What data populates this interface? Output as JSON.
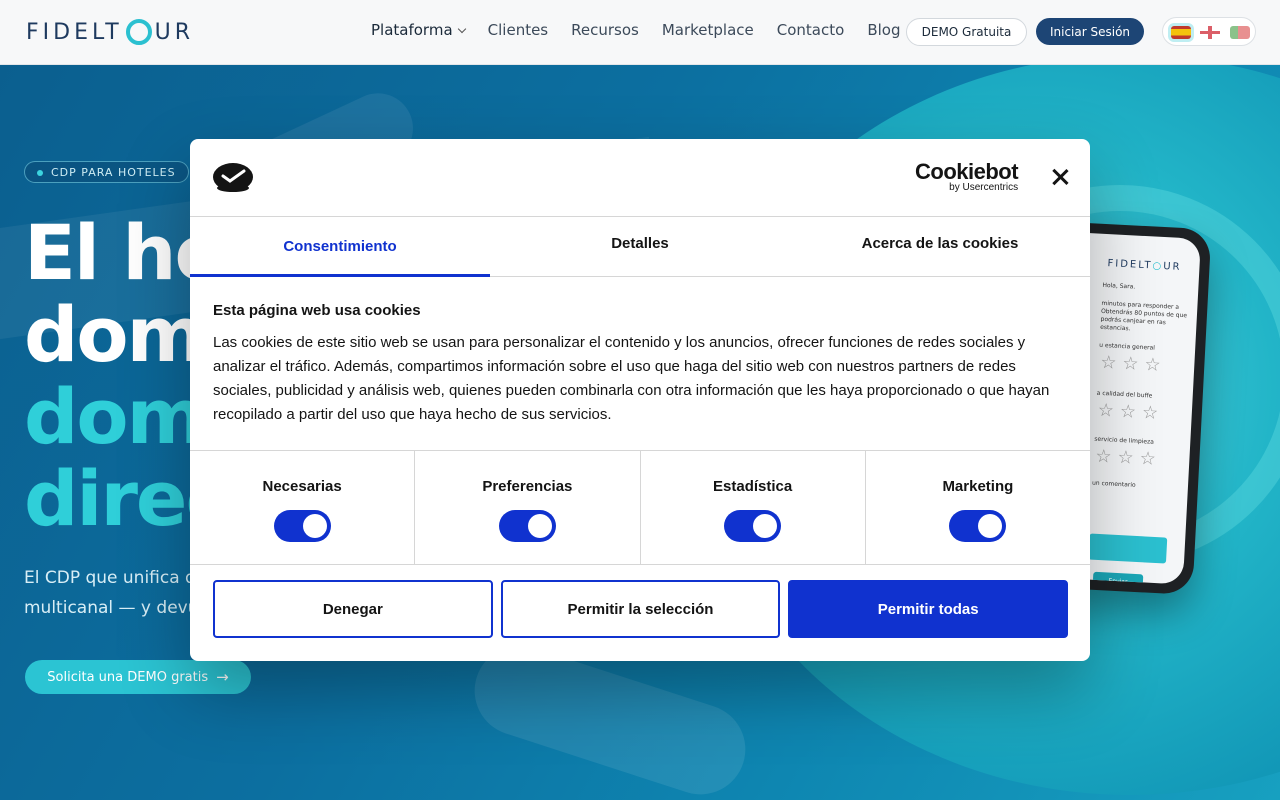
{
  "header": {
    "logo_left": "FIDELT",
    "logo_right": "UR",
    "nav": [
      {
        "label": "Plataforma",
        "has_dropdown": true
      },
      {
        "label": "Clientes"
      },
      {
        "label": "Recursos"
      },
      {
        "label": "Marketplace"
      },
      {
        "label": "Contacto"
      },
      {
        "label": "Blog"
      }
    ],
    "demo_button": "DEMO Gratuita",
    "login_button": "Iniciar Sesión",
    "languages": [
      "es",
      "en",
      "pt"
    ]
  },
  "hero": {
    "badge": "CDP PARA HOTELES",
    "headline": [
      "El ho",
      "dom",
      "dom",
      "direc"
    ],
    "subtitle_line1": "El CDP que unifica d",
    "subtitle_line2": "multicanal — y devu",
    "cta": "Solicita una DEMO gratis"
  },
  "phone": {
    "logo_left": "FIDELT",
    "logo_right": "UR",
    "greeting": "Hola, Sara.",
    "intro": "minutos para responder a Obtendrás 80 puntos de que podrás canjear en ras estancias.",
    "q1": "u estancia general",
    "q2": "a calidad del buffe",
    "q3": "servicio de limpieza",
    "q4": "un comentario",
    "send": "Enviar"
  },
  "cookie_dialog": {
    "brand": "Cookiebot",
    "brand_sub": "by Usercentrics",
    "tabs": [
      {
        "label": "Consentimiento",
        "active": true
      },
      {
        "label": "Detalles",
        "active": false
      },
      {
        "label": "Acerca de las cookies",
        "active": false
      }
    ],
    "title": "Esta página web usa cookies",
    "text": "Las cookies de este sitio web se usan para personalizar el contenido y los anuncios, ofrecer funciones de redes sociales y analizar el tráfico. Además, compartimos información sobre el uso que haga del sitio web con nuestros partners de redes sociales, publicidad y análisis web, quienes pueden combinarla con otra información que les haya proporcionado o que hayan recopilado a partir del uso que haya hecho de sus servicios.",
    "toggles": [
      {
        "label": "Necesarias",
        "on": true
      },
      {
        "label": "Preferencias",
        "on": true
      },
      {
        "label": "Estadística",
        "on": true
      },
      {
        "label": "Marketing",
        "on": true
      }
    ],
    "buttons": {
      "deny": "Denegar",
      "allow_selection": "Permitir la selección",
      "allow_all": "Permitir todas"
    },
    "accent_color": "#1032cf"
  }
}
